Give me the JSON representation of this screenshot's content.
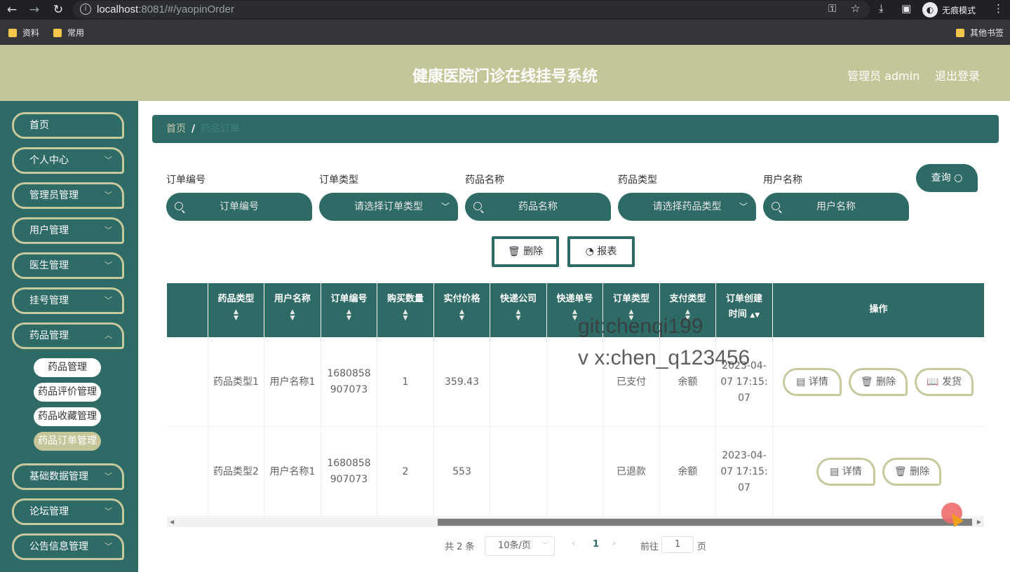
{
  "browser": {
    "url_host": "localhost",
    "url_rest": ":8081/#/yaopinOrder",
    "incognito_label": "无痕模式",
    "bookmarks": [
      "资料",
      "常用"
    ],
    "other_bookmarks": "其他书签"
  },
  "header": {
    "title": "健康医院门诊在线挂号系统",
    "admin_label": "管理员 admin",
    "logout_label": "退出登录"
  },
  "sidebar": {
    "items": [
      {
        "label": "首页"
      },
      {
        "label": "个人中心"
      },
      {
        "label": "管理员管理"
      },
      {
        "label": "用户管理"
      },
      {
        "label": "医生管理"
      },
      {
        "label": "挂号管理"
      },
      {
        "label": "药品管理"
      },
      {
        "label": "基础数据管理"
      },
      {
        "label": "论坛管理"
      },
      {
        "label": "公告信息管理"
      }
    ],
    "sub_items": [
      {
        "label": "药品管理"
      },
      {
        "label": "药品评价管理"
      },
      {
        "label": "药品收藏管理"
      },
      {
        "label": "药品订单管理"
      }
    ]
  },
  "breadcrumb": {
    "home": "首页",
    "separator": "/",
    "current": "药品订单"
  },
  "filters": [
    {
      "label": "订单编号",
      "placeholder": "订单编号"
    },
    {
      "label": "订单类型",
      "placeholder": "请选择订单类型"
    },
    {
      "label": "药品名称",
      "placeholder": "药品名称"
    },
    {
      "label": "药品类型",
      "placeholder": "请选择药品类型"
    },
    {
      "label": "用户名称",
      "placeholder": "用户名称"
    }
  ],
  "query_label": "查询",
  "actions": {
    "delete_label": "删除",
    "report_label": "报表"
  },
  "table": {
    "columns": [
      "药品类型",
      "用户名称",
      "订单编号",
      "购买数量",
      "实付价格",
      "快递公司",
      "快递单号",
      "订单类型",
      "支付类型",
      "订单创建时间",
      "操作"
    ],
    "rows": [
      {
        "cells": [
          "药品类型1",
          "用户名称1",
          "1680858907073",
          "1",
          "359.43",
          "",
          "",
          "已支付",
          "余额",
          "2023-04-07 17:15:07"
        ],
        "ops": [
          "详情",
          "删除",
          "发货"
        ]
      },
      {
        "cells": [
          "药品类型2",
          "用户名称1",
          "1680858907073",
          "2",
          "553",
          "",
          "",
          "已退款",
          "余额",
          "2023-04-07 17:15:07"
        ],
        "ops": [
          "详情",
          "删除"
        ]
      }
    ]
  },
  "pagination": {
    "total": "共 2 条",
    "page_size": "10条/页",
    "current_page": "1",
    "goto_label": "前往",
    "goto_value": "1",
    "page_unit": "页"
  },
  "watermark": {
    "line1": "git:chenqi199",
    "line2": "v x:chen_q123456"
  },
  "colors": {
    "primary": "#2e6a66",
    "accent": "#c4c599",
    "button_border": "#c8c89e"
  }
}
